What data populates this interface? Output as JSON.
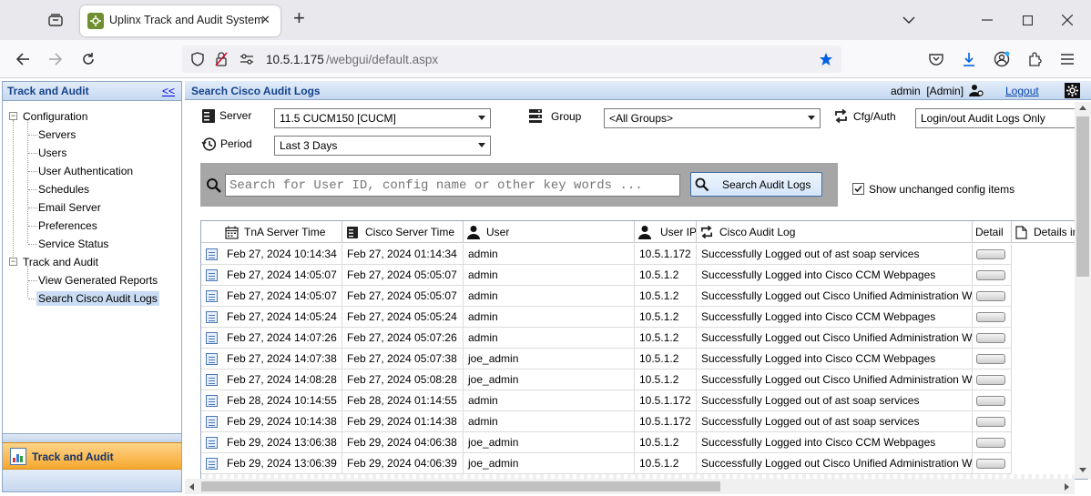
{
  "browser": {
    "tab_title": "Uplinx Track and Audit System",
    "tab_close": "✕",
    "new_tab": "+",
    "url_host": "10.5.1.175",
    "url_path": "/webgui/default.aspx"
  },
  "sidebar": {
    "title": "Track and Audit",
    "collapse_label": "<<",
    "tree": [
      {
        "label": "Configuration",
        "level": 0,
        "expander": "−"
      },
      {
        "label": "Servers",
        "level": 1
      },
      {
        "label": "Users",
        "level": 1
      },
      {
        "label": "User Authentication",
        "level": 1
      },
      {
        "label": "Schedules",
        "level": 1
      },
      {
        "label": "Email Server",
        "level": 1
      },
      {
        "label": "Preferences",
        "level": 1
      },
      {
        "label": "Service Status",
        "level": 1
      },
      {
        "label": "Track and Audit",
        "level": 0,
        "expander": "−"
      },
      {
        "label": "View Generated Reports",
        "level": 1
      },
      {
        "label": "Search Cisco Audit Logs",
        "level": 1,
        "selected": true
      }
    ],
    "bottom_nav_label": "Track and Audit"
  },
  "header": {
    "title": "Search Cisco Audit Logs",
    "user": "admin  [Admin]",
    "logout": "Logout"
  },
  "filters": {
    "server_label": "Server",
    "server_value": "11.5 CUCM150 [CUCM]",
    "group_label": "Group",
    "group_value": "<All Groups>",
    "cfg_label": "Cfg/Auth",
    "cfg_value": "Login/out Audit Logs Only",
    "period_label": "Period",
    "period_value": "Last 3 Days",
    "search_placeholder": "Search for User ID, config name or other key words ...",
    "search_button": "Search Audit Logs",
    "show_unchanged_label": "Show unchanged config items",
    "show_unchanged_checked": true
  },
  "grid": {
    "columns": [
      "TnA Server Time",
      "Cisco Server Time",
      "User",
      "User IP",
      "Cisco Audit Log",
      "Detail",
      "Details in"
    ],
    "rows": [
      [
        "Feb 27, 2024 10:14:34",
        "Feb 27, 2024 01:14:34",
        "admin",
        "10.5.1.172",
        "Successfully Logged out of ast soap services"
      ],
      [
        "Feb 27, 2024 14:05:07",
        "Feb 27, 2024 05:05:07",
        "admin",
        "10.5.1.2",
        "Successfully Logged into Cisco CCM Webpages"
      ],
      [
        "Feb 27, 2024 14:05:07",
        "Feb 27, 2024 05:05:07",
        "admin",
        "10.5.1.2",
        "Successfully Logged out Cisco Unified Administration Web"
      ],
      [
        "Feb 27, 2024 14:05:24",
        "Feb 27, 2024 05:05:24",
        "admin",
        "10.5.1.2",
        "Successfully Logged into Cisco CCM Webpages"
      ],
      [
        "Feb 27, 2024 14:07:26",
        "Feb 27, 2024 05:07:26",
        "admin",
        "10.5.1.2",
        "Successfully Logged out Cisco Unified Administration Web"
      ],
      [
        "Feb 27, 2024 14:07:38",
        "Feb 27, 2024 05:07:38",
        "joe_admin",
        "10.5.1.2",
        "Successfully Logged into Cisco CCM Webpages"
      ],
      [
        "Feb 27, 2024 14:08:28",
        "Feb 27, 2024 05:08:28",
        "joe_admin",
        "10.5.1.2",
        "Successfully Logged out Cisco Unified Administration Web"
      ],
      [
        "Feb 28, 2024 10:14:55",
        "Feb 28, 2024 01:14:55",
        "admin",
        "10.5.1.172",
        "Successfully Logged out of ast soap services"
      ],
      [
        "Feb 29, 2024 10:14:38",
        "Feb 29, 2024 01:14:38",
        "admin",
        "10.5.1.172",
        "Successfully Logged out of ast soap services"
      ],
      [
        "Feb 29, 2024 13:06:38",
        "Feb 29, 2024 04:06:38",
        "joe_admin",
        "10.5.1.2",
        "Successfully Logged into Cisco CCM Webpages"
      ],
      [
        "Feb 29, 2024 13:06:39",
        "Feb 29, 2024 04:06:39",
        "joe_admin",
        "10.5.1.2",
        "Successfully Logged out Cisco Unified Administration Web"
      ]
    ]
  },
  "colors": {
    "header_gradient_top": "#e3edf9",
    "header_gradient_bottom": "#c5d8f1",
    "header_text": "#15428b",
    "search_band": "#a6a6a6",
    "selected_item_bg": "#c9dcf3",
    "orange_nav": "#fbb040"
  }
}
